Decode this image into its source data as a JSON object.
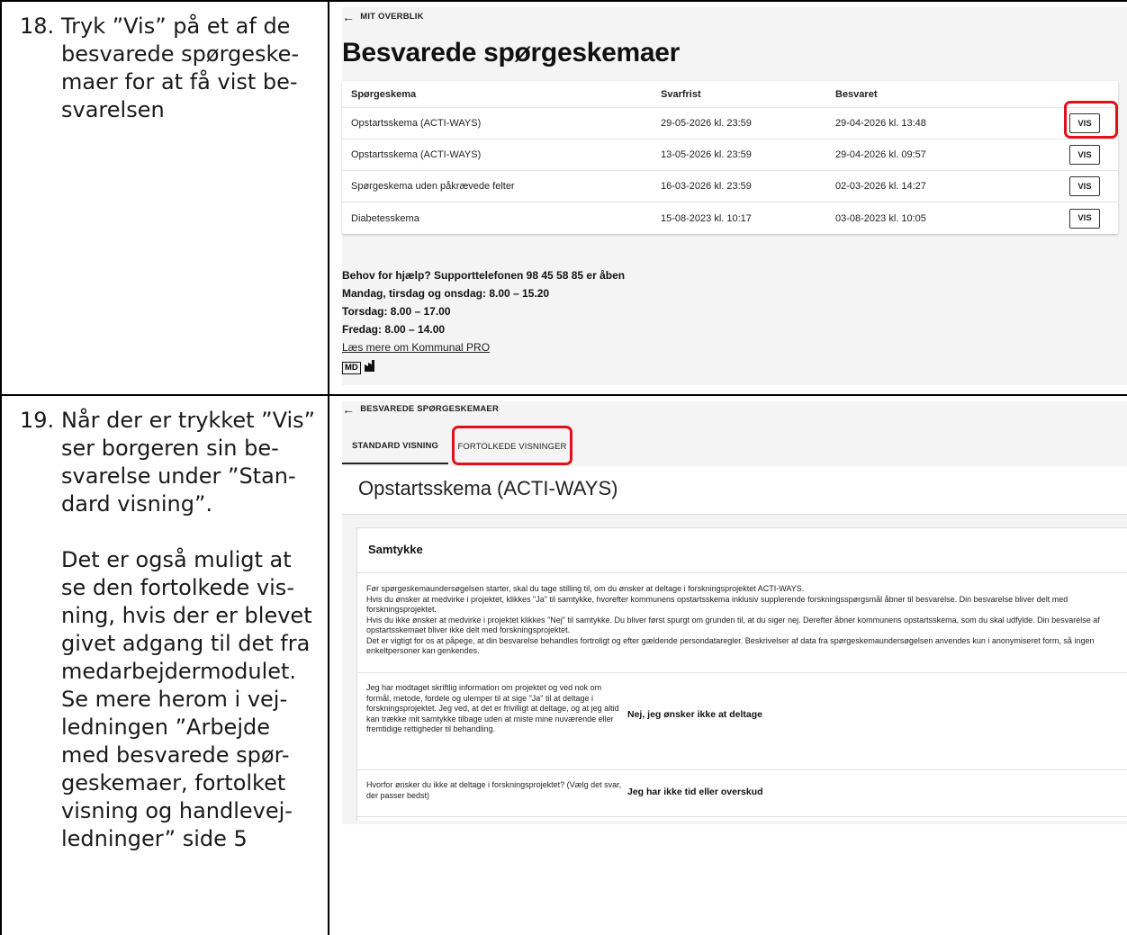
{
  "step18": {
    "number": "18.",
    "lines": [
      "Tryk ”Vis” på et af de",
      "besvarede spørgeske-",
      "maer for at få vist be-",
      "svarelsen"
    ]
  },
  "step19": {
    "number": "19.",
    "lines": [
      "Når der er trykket ”Vis”",
      "ser borgeren sin be-",
      "svarelse under ”Stan-",
      "dard visning”.",
      "",
      "Det er også muligt at",
      "se den fortolkede vis-",
      "ning, hvis der er blevet",
      "givet adgang til det fra",
      "medarbejdermodulet.",
      "Se mere herom i vej-",
      "ledningen ”Arbejde",
      "med besvarede spør-",
      "geskemaer, fortolket",
      "visning og handlevej-",
      "ledninger” side 5"
    ]
  },
  "shot1": {
    "back_label": "MIT OVERBLIK",
    "title": "Besvarede spørgeskemaer",
    "columns": [
      "Spørgeskema",
      "Svarfrist",
      "Besvaret"
    ],
    "rows": [
      {
        "name": "Opstartsskema (ACTI-WAYS)",
        "deadline": "29-05-2026 kl. 23:59",
        "answered": "29-04-2026 kl. 13:48",
        "button": "VIS"
      },
      {
        "name": "Opstartsskema (ACTI-WAYS)",
        "deadline": "13-05-2026 kl. 23:59",
        "answered": "29-04-2026 kl. 09:57",
        "button": "VIS"
      },
      {
        "name": "Spørgeskema uden påkrævede felter",
        "deadline": "16-03-2026 kl. 23:59",
        "answered": "02-03-2026 kl. 14:27",
        "button": "VIS"
      },
      {
        "name": "Diabetesskema",
        "deadline": "15-08-2023 kl. 10:17",
        "answered": "03-08-2023 kl. 10:05",
        "button": "VIS"
      }
    ],
    "help": {
      "line1": "Behov for hjælp? Supporttelefonen 98 45 58 85 er åben",
      "line2": "Mandag, tirsdag og onsdag: 8.00 – 15.20",
      "line3": "Torsdag: 8.00 – 17.00",
      "line4": "Fredag: 8.00 – 14.00",
      "link": "Læs mere om Kommunal PRO"
    },
    "md_badge": "MD",
    "factory_icon": "factory-icon"
  },
  "shot2": {
    "back_label": "BESVAREDE SPØRGESKEMAER",
    "tabs": [
      "STANDARD VISNING",
      "FORTOLKEDE VISNINGER"
    ],
    "title": "Opstartsskema (ACTI-WAYS)",
    "section_title": "Samtykke",
    "consent": [
      "Før spørgeskemaundersøgelsen starter, skal du tage stilling til, om du ønsker at deltage i forskningsprojektet ACTI-WAYS.",
      "Hvis du ønsker at medvirke i projektet, klikkes \"Ja\" til samtykke, hvorefter kommunens opstartsskema inklusiv supplerende forskningsspørgsmål åbner til besvarelse. Din besvarelse bliver delt med forskningsprojektet.",
      "Hvis du ikke ønsker at medvirke i projektet klikkes \"Nej\" til samtykke. Du bliver først spurgt om grunden til, at du siger nej. Derefter åbner kommunens opstartsskema, som du skal udfylde. Din besvarelse af opstartsskemaet bliver ikke delt med forskningsprojektet.",
      "Det er vigtigt for os at påpege, at din besvarelse behandles fortroligt og efter gældende persondataregler. Beskrivelser af data fra spørgeskemaundersøgelsen anvendes kun i anonymiseret form, så ingen enkeltpersoner kan genkendes."
    ],
    "qa": [
      {
        "q": "Jeg har modtaget skriftlig information om projektet og ved nok om formål, metode, fordele og ulemper til at sige \"Ja\" til at deltage i forskningsprojektet. Jeg ved, at det er frivilligt at deltage, og at jeg altid kan trække mit samtykke tilbage uden at miste mine nuværende eller fremtidige rettigheder til behandling.",
        "a": "Nej, jeg ønsker ikke at deltage"
      },
      {
        "q": "Hvorfor ønsker du ikke at deltage i forskningsprojektet? (Vælg det svar, der passer bedst)",
        "a": "Jeg har ikke tid eller overskud"
      }
    ]
  },
  "colors": {
    "highlight": "#e3101a",
    "panel_bg": "#f4f4f4"
  }
}
